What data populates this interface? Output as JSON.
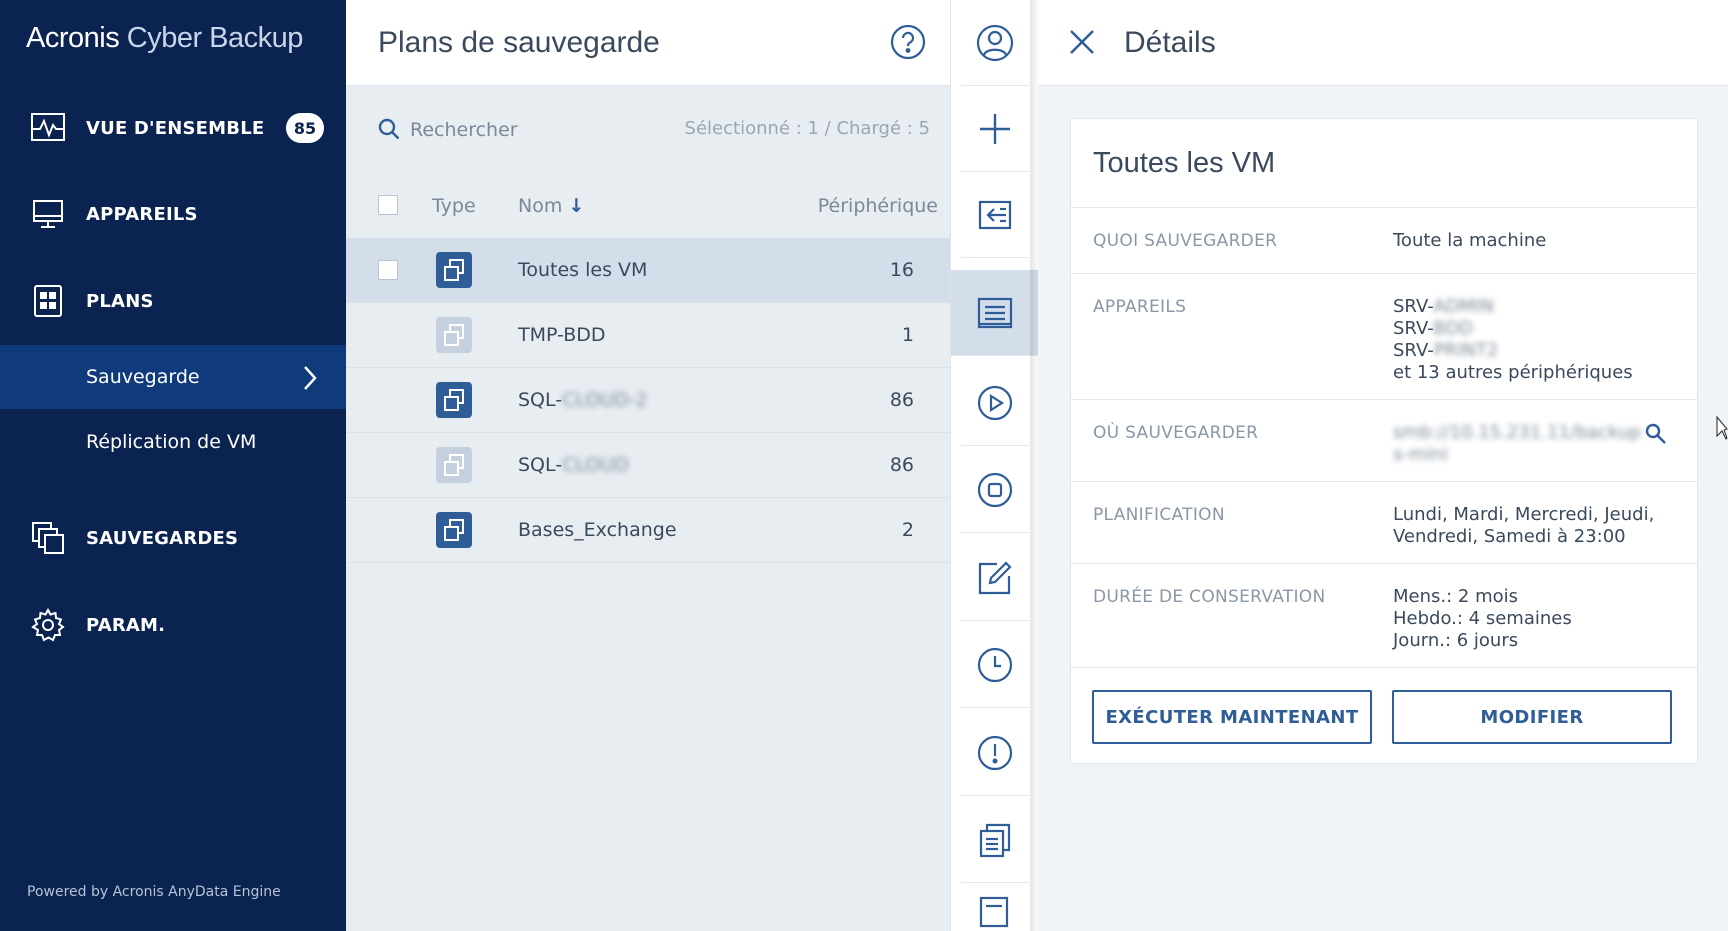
{
  "brand": {
    "part1": "Acronis",
    "part2": "Cyber Backup"
  },
  "nav": {
    "overview": {
      "label": "VUE D'ENSEMBLE",
      "badge": "85"
    },
    "devices": {
      "label": "APPAREILS"
    },
    "plans": {
      "label": "PLANS"
    },
    "sub_backup": {
      "label": "Sauvegarde"
    },
    "sub_replication": {
      "label": "Réplication de VM"
    },
    "backups": {
      "label": "SAUVEGARDES"
    },
    "settings": {
      "label": "PARAM."
    }
  },
  "powered_by": "Powered by Acronis AnyData Engine",
  "list": {
    "title": "Plans de sauvegarde",
    "search_placeholder": "Rechercher",
    "selection": "Sélectionné : 1 / Chargé : 5",
    "columns": {
      "type": "Type",
      "name": "Nom",
      "sort_arrow": "↓",
      "devices": "Périphérique"
    },
    "rows": [
      {
        "name": "Toutes les VM",
        "count": "16"
      },
      {
        "name": "TMP-BDD",
        "count": "1"
      },
      {
        "name_prefix": "SQL-",
        "name_blurred": "CLOUD-2",
        "count": "86"
      },
      {
        "name_prefix": "SQL-",
        "name_blurred": "CLOUD",
        "count": "86"
      },
      {
        "name": "Bases_Exchange",
        "count": "2"
      }
    ]
  },
  "details": {
    "header": "Détails",
    "card_title": "Toutes les VM",
    "what": {
      "label": "QUOI SAUVEGARDER",
      "value": "Toute la machine"
    },
    "devices": {
      "label": "APPAREILS",
      "line1_prefix": "SRV-",
      "line1_blur": "ADMIN",
      "line2_prefix": "SRV-",
      "line2_blur": "BDD",
      "line3_prefix": "SRV-",
      "line3_blur": "PRINT2",
      "more": "et 13 autres périphériques"
    },
    "where": {
      "label": "OÙ SAUVEGARDER",
      "line1_blur": "smb://10.15.231.11/backup",
      "line2_blur": "s-mini"
    },
    "schedule": {
      "label": "PLANIFICATION",
      "line1": "Lundi, Mardi, Mercredi, Jeudi,",
      "line2": "Vendredi, Samedi à 23:00"
    },
    "retention": {
      "label": "DURÉE DE CONSERVATION",
      "line1": "Mens.: 2 mois",
      "line2": "Hebdo.: 4 semaines",
      "line3": "Journ.: 6 jours"
    },
    "run_now": "EXÉCUTER MAINTENANT",
    "edit": "MODIFIER"
  },
  "colors": {
    "sidebar": "#0b2350",
    "sidebar_active": "#0f3b7d",
    "accent": "#2f5d97",
    "selected_row": "#d3deea"
  }
}
